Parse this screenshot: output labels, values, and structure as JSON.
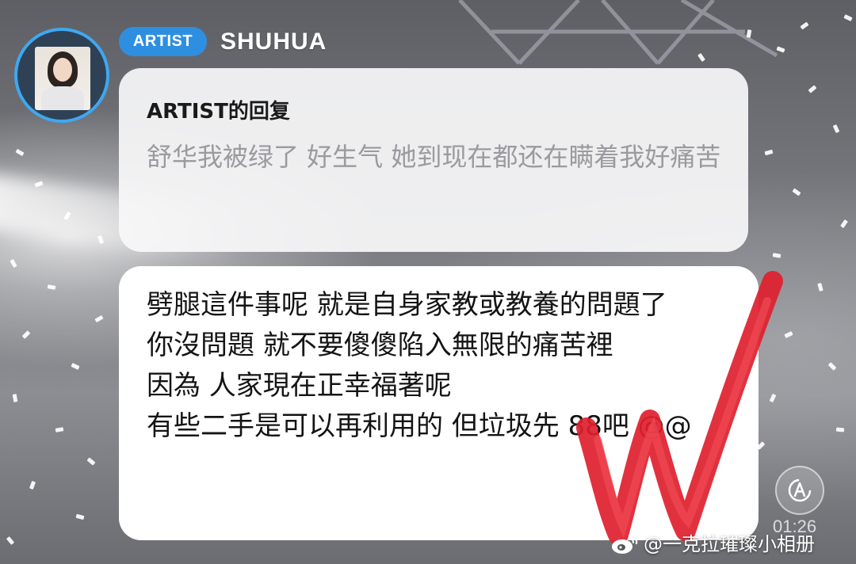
{
  "header": {
    "badge_label": "ARTIST",
    "username": "SHUHUA"
  },
  "reply": {
    "heading": "ARTIST的回复",
    "quoted_message": "舒华我被绿了 好生气 她到现在都还在瞒着我好痛苦"
  },
  "message": {
    "text": "劈腿這件事呢 就是自身家教或教養的問題了\n你沒問題 就不要傻傻陷入無限的痛苦裡\n因為 人家現在正幸福著呢\n有些二手是可以再利用的 但垃圾先 88吧 @@"
  },
  "video": {
    "timestamp": "01:26"
  },
  "watermark": {
    "text": "@一克拉璀璨小相册"
  },
  "icons": {
    "avatar": "profile-photo",
    "control": "auto-rotate-icon",
    "watermark_logo": "weibo-logo-icon"
  },
  "colors": {
    "accent_blue": "#2e8fe0",
    "scribble_red": "#e0202e"
  }
}
